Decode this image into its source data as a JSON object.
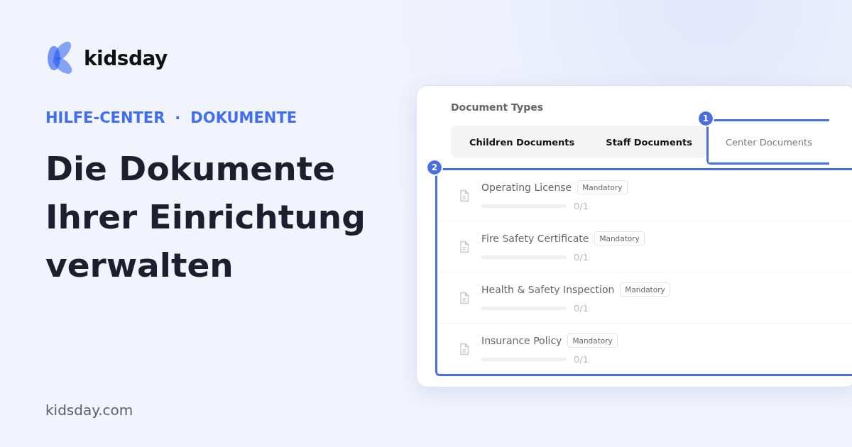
{
  "brand": {
    "name": "kidsday"
  },
  "breadcrumb": {
    "items": [
      "HILFE-CENTER",
      "DOKUMENTE"
    ],
    "separator": "·"
  },
  "headline": "Die Dokumente Ihrer Einrichtung verwalten",
  "footer": "kidsday.com",
  "screenshot": {
    "section_title": "Document Types",
    "tabs": [
      {
        "label": "Children Documents",
        "selected": false
      },
      {
        "label": "Staff Documents",
        "selected": false
      },
      {
        "label": "Center Documents",
        "selected": true
      }
    ],
    "tab_callout": "1",
    "list_callout": "2",
    "documents": [
      {
        "name": "Operating License",
        "tag": "Mandatory",
        "level": 0,
        "count": "0/1"
      },
      {
        "name": "Fire Safety Certificate",
        "tag": "Mandatory",
        "level": 0,
        "count": "0/1"
      },
      {
        "name": "Health & Safety Inspection",
        "tag": "Mandatory",
        "level": 0,
        "count": "0/1"
      },
      {
        "name": "Insurance Policy",
        "tag": "Mandatory",
        "level": 0,
        "count": "0/1"
      }
    ]
  }
}
